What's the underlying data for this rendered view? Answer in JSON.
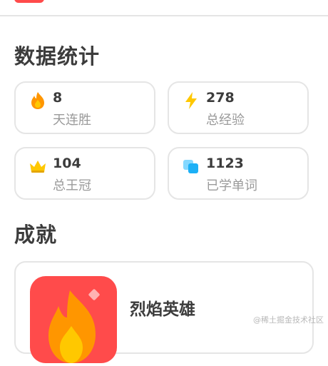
{
  "stats_section": {
    "title": "数据统计",
    "cards": [
      {
        "value": "8",
        "label": "天连胜",
        "icon": "flame-icon"
      },
      {
        "value": "278",
        "label": "总经验",
        "icon": "lightning-icon"
      },
      {
        "value": "104",
        "label": "总王冠",
        "icon": "crown-icon"
      },
      {
        "value": "1123",
        "label": "已学单词",
        "icon": "cards-icon"
      }
    ]
  },
  "achievements_section": {
    "title": "成就",
    "items": [
      {
        "title": "烈焰英雄",
        "icon": "flame-badge-icon"
      }
    ]
  },
  "watermark": "@稀土掘金技术社区",
  "colors": {
    "accent_red": "#ff4b4b",
    "flame_orange": "#ff9600",
    "lightning_yellow": "#ffc800",
    "cards_blue": "#1cb0f6",
    "border_gray": "#e5e5e5"
  }
}
